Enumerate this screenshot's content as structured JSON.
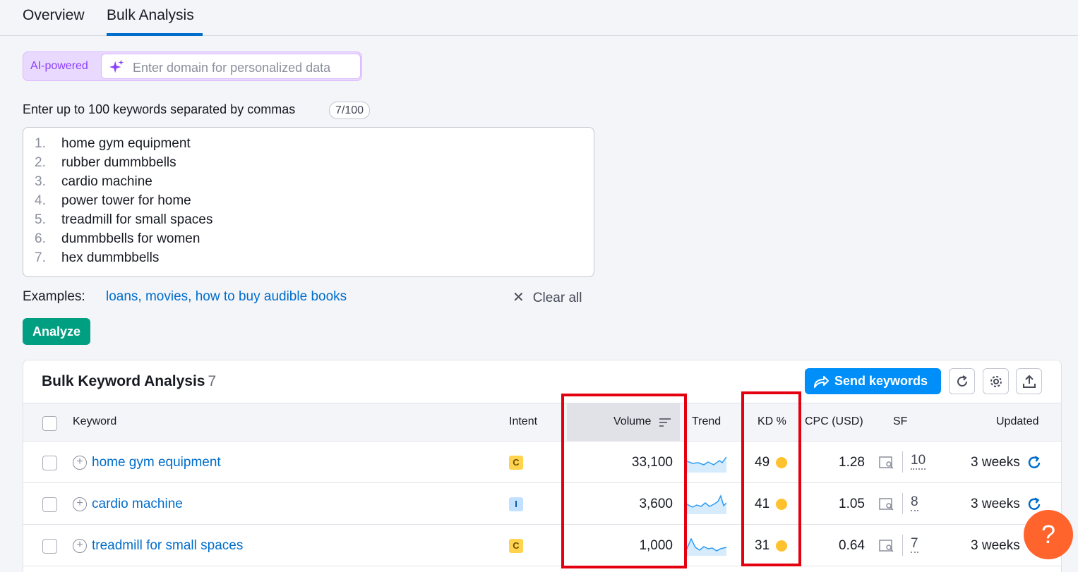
{
  "tabs": [
    {
      "label": "Overview"
    },
    {
      "label": "Bulk Analysis"
    }
  ],
  "ai": {
    "badge": "AI-powered",
    "placeholder": "Enter domain for personalized data"
  },
  "keywords_input": {
    "label": "Enter up to 100 keywords separated by commas",
    "count": "7/100",
    "lines": [
      {
        "num": "1.",
        "text": "home gym equipment"
      },
      {
        "num": "2.",
        "text": "rubber dummbbells"
      },
      {
        "num": "3.",
        "text": "cardio machine"
      },
      {
        "num": "4.",
        "text": "power tower for home"
      },
      {
        "num": "5.",
        "text": "treadmill for small spaces"
      },
      {
        "num": "6.",
        "text": "dummbbells for women"
      },
      {
        "num": "7.",
        "text": "hex dummbbells"
      }
    ]
  },
  "examples": {
    "label": "Examples:",
    "links": "loans, movies, how to buy audible books",
    "clear_all": "Clear all"
  },
  "analyze_label": "Analyze",
  "table": {
    "title": "Bulk Keyword Analysis",
    "count": "7",
    "send_label": "Send keywords",
    "headers": {
      "keyword": "Keyword",
      "intent": "Intent",
      "volume": "Volume",
      "trend": "Trend",
      "kd": "KD %",
      "cpc": "CPC (USD)",
      "sf": "SF",
      "updated": "Updated"
    },
    "rows": [
      {
        "keyword": "home gym equipment",
        "intent": "C",
        "volume": "33,100",
        "kd": "49",
        "cpc": "1.28",
        "sf": "10",
        "updated": "3 weeks"
      },
      {
        "keyword": "cardio machine",
        "intent": "I",
        "volume": "3,600",
        "kd": "41",
        "cpc": "1.05",
        "sf": "8",
        "updated": "3 weeks"
      },
      {
        "keyword": "treadmill for small spaces",
        "intent": "C",
        "volume": "1,000",
        "kd": "31",
        "cpc": "0.64",
        "sf": "7",
        "updated": "3 weeks"
      }
    ]
  },
  "help_label": "?",
  "colors": {
    "accent_blue": "#006dca",
    "analyze_green": "#009f81",
    "send_blue": "#008ff8",
    "kd_yellow": "#ffc22e",
    "highlight_red": "#e3000f",
    "help_orange": "#ff642d"
  }
}
